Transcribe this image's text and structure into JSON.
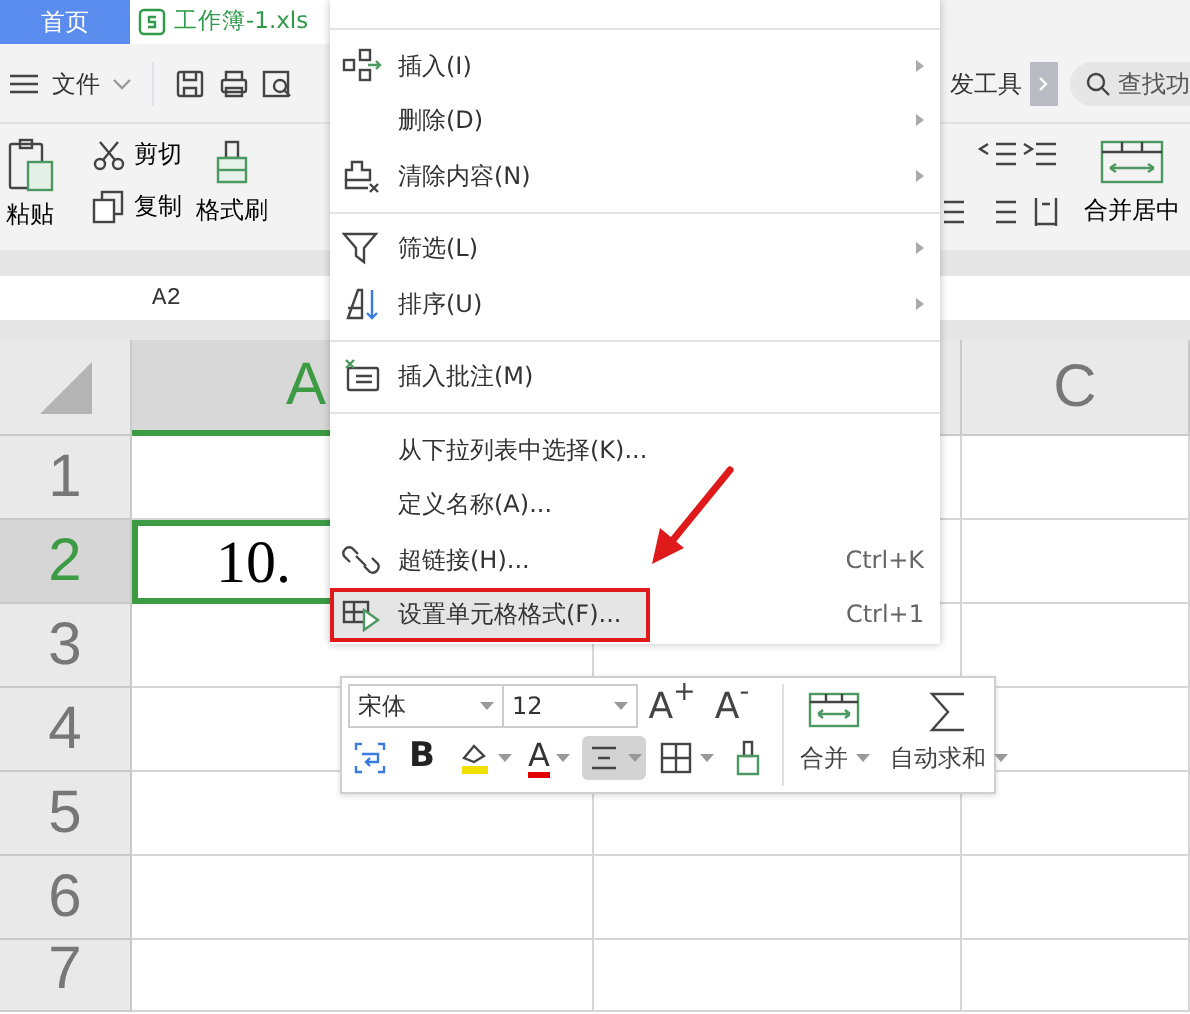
{
  "tabs": [
    {
      "label": "首页",
      "selected": false,
      "kind": "home"
    },
    {
      "label": "工作簿-1.xls",
      "selected": true,
      "kind": "sheet"
    }
  ],
  "menu_bar": {
    "file_label": "文件",
    "tab_label": "发工具",
    "search_placeholder": "查找功"
  },
  "ribbon": {
    "buttons": [
      {
        "label": "粘贴",
        "kind": "paste"
      },
      {
        "label": "剪切",
        "kind": "cut"
      },
      {
        "label": "复制",
        "kind": "copy"
      },
      {
        "label": "格式刷",
        "kind": "painter"
      },
      {
        "label": "合并居中",
        "kind": "merge"
      }
    ]
  },
  "name_box": "A2",
  "sheet": {
    "columns": [
      {
        "label": "A",
        "selected": true
      },
      {
        "label": "C",
        "selected": false
      }
    ],
    "rows": [
      {
        "label": "1",
        "selected": false
      },
      {
        "label": "2",
        "selected": true,
        "cell": "10."
      },
      {
        "label": "3",
        "selected": false
      },
      {
        "label": "4",
        "selected": false
      },
      {
        "label": "5",
        "selected": false
      },
      {
        "label": "6",
        "selected": false
      },
      {
        "label": "7",
        "selected": false
      }
    ]
  },
  "context_menu": {
    "items": [
      {
        "label": "插入(I)",
        "kind": "insert",
        "submenu": true,
        "separator_before": true
      },
      {
        "label": "删除(D)",
        "kind": "plain",
        "submenu": true
      },
      {
        "label": "清除内容(N)",
        "kind": "clear",
        "submenu": true
      },
      {
        "label": "筛选(L)",
        "kind": "filter",
        "submenu": true,
        "separator_before": true
      },
      {
        "label": "排序(U)",
        "kind": "sort",
        "submenu": true
      },
      {
        "label": "插入批注(M)",
        "kind": "comment",
        "separator_before": true
      },
      {
        "label": "从下拉列表中选择(K)...",
        "kind": "plain",
        "separator_before": true
      },
      {
        "label": "定义名称(A)...",
        "kind": "plain"
      },
      {
        "label": "超链接(H)...",
        "kind": "link",
        "shortcut": "Ctrl+K"
      },
      {
        "label": "设置单元格格式(F)...",
        "kind": "format",
        "shortcut": "Ctrl+1",
        "hovered": true,
        "annotated": true
      }
    ]
  },
  "mini_toolbar": {
    "font": "宋体",
    "size": "12",
    "grow_label": "A$^{+}$",
    "shrink_label": "A$^{-}$",
    "tools": [
      {
        "kind": "wrap",
        "selected": false
      },
      {
        "kind": "bold",
        "label": "B",
        "selected": false
      },
      {
        "kind": "fill",
        "selected": false
      },
      {
        "kind": "font_color",
        "label": "A",
        "selected": false
      },
      {
        "kind": "align",
        "selected": true
      },
      {
        "kind": "borders",
        "selected": false
      },
      {
        "kind": "painter",
        "selected": false
      }
    ],
    "merge_label": "合并",
    "sum_label": "自动求和"
  }
}
